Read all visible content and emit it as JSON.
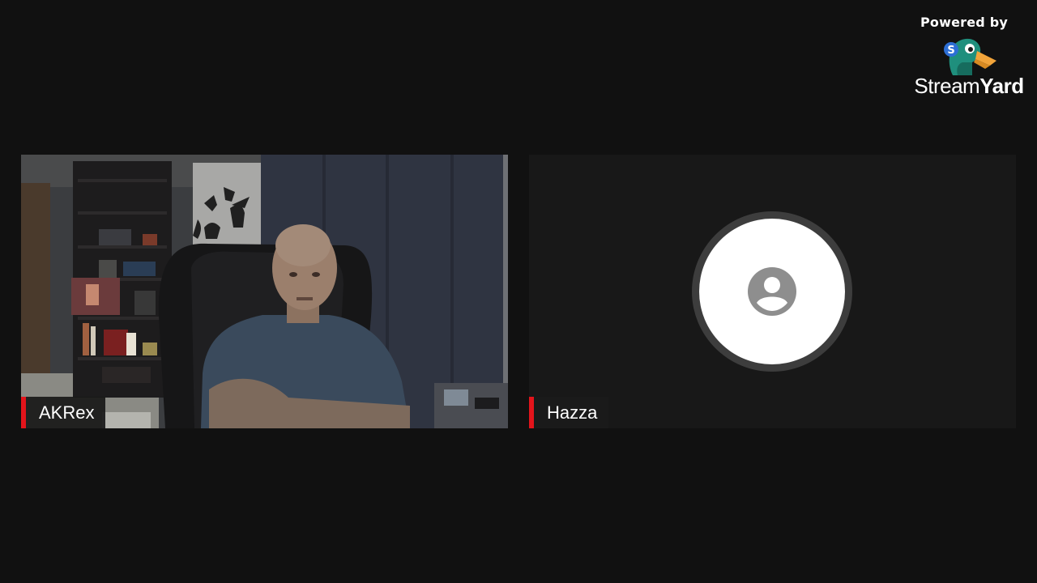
{
  "branding": {
    "powered_by": "Powered by",
    "wordmark_light": "Stream",
    "wordmark_bold": "Yard",
    "logo_icon": "streamyard-duck-icon"
  },
  "participants": [
    {
      "name": "AKRex",
      "has_video": true
    },
    {
      "name": "Hazza",
      "has_video": false,
      "placeholder_icon": "person-avatar-icon"
    }
  ],
  "colors": {
    "background": "#111111",
    "name_tag_accent": "#e3141b",
    "avatar_ring": "#3d3d3d",
    "avatar_glyph": "#8e8e8e"
  }
}
